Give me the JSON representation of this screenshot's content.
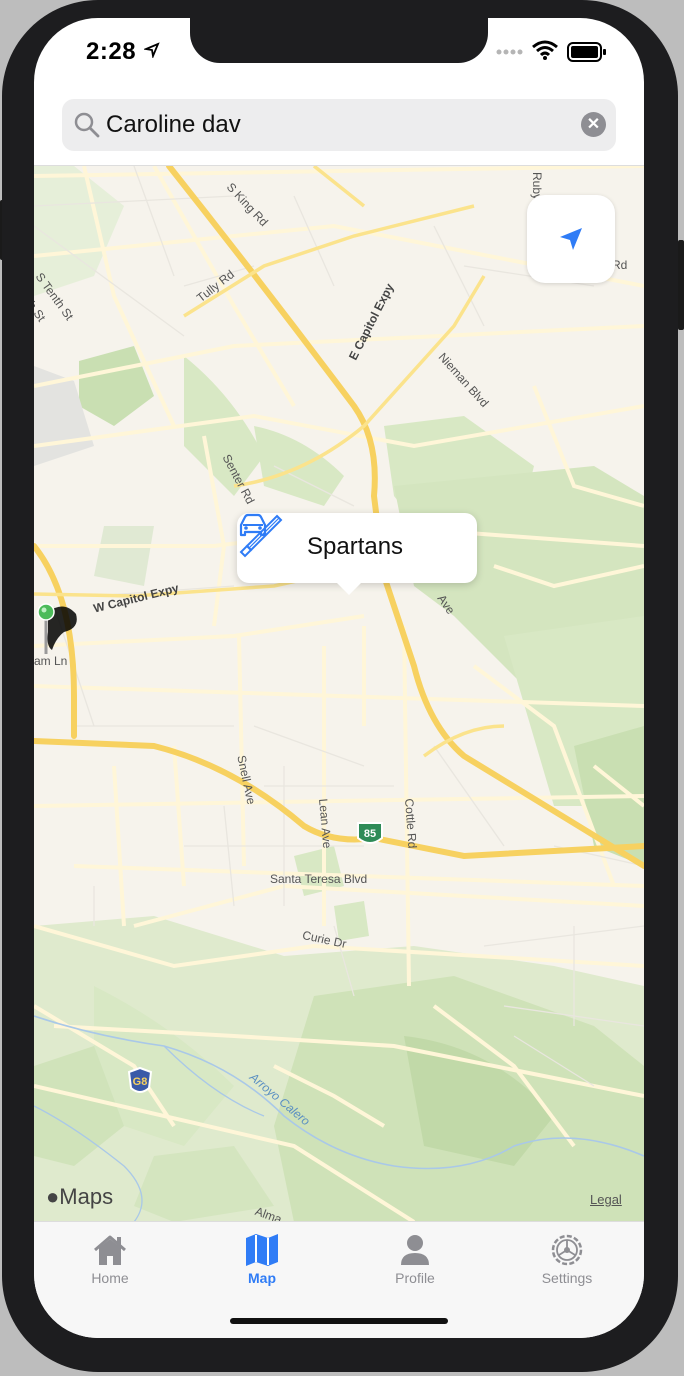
{
  "status_bar": {
    "time": "2:28",
    "icons": [
      "location-arrow-icon",
      "signal-icon",
      "wifi-icon",
      "battery-icon"
    ]
  },
  "search": {
    "value": "Caroline dav",
    "icon": "search-icon",
    "clear_icon": "clear-icon"
  },
  "map": {
    "road_labels": [
      "S King Rd",
      "Tully Rd",
      "S Tenth St",
      "th St",
      "E Capitol Expy",
      "Nieman Blvd",
      "Senter Rd",
      "W Capitol Expy",
      "am Ln",
      "Ave",
      "Snell Ave",
      "Lean Ave",
      "Cottle Rd",
      "Santa Teresa Blvd",
      "Curie Dr",
      "Arroyo Calero",
      "Alma",
      "Ruby",
      "Rd"
    ],
    "shields": [
      "85",
      "G8"
    ],
    "attribution": "Maps",
    "legal": "Legal",
    "colors": {
      "land": "#f6f3ec",
      "park": "#d8e8c4",
      "highway": "#f7d160",
      "road": "#fff4cf"
    }
  },
  "callout": {
    "title": "Spartans",
    "left_icon": "car-icon",
    "right_icon": "bat-icon",
    "accent": "#2f7cf6"
  },
  "tabbar": {
    "tabs": [
      {
        "label": "Home",
        "icon": "home-icon",
        "active": false
      },
      {
        "label": "Map",
        "icon": "map-icon",
        "active": true
      },
      {
        "label": "Profile",
        "icon": "profile-icon",
        "active": false
      },
      {
        "label": "Settings",
        "icon": "settings-icon",
        "active": false
      }
    ]
  }
}
